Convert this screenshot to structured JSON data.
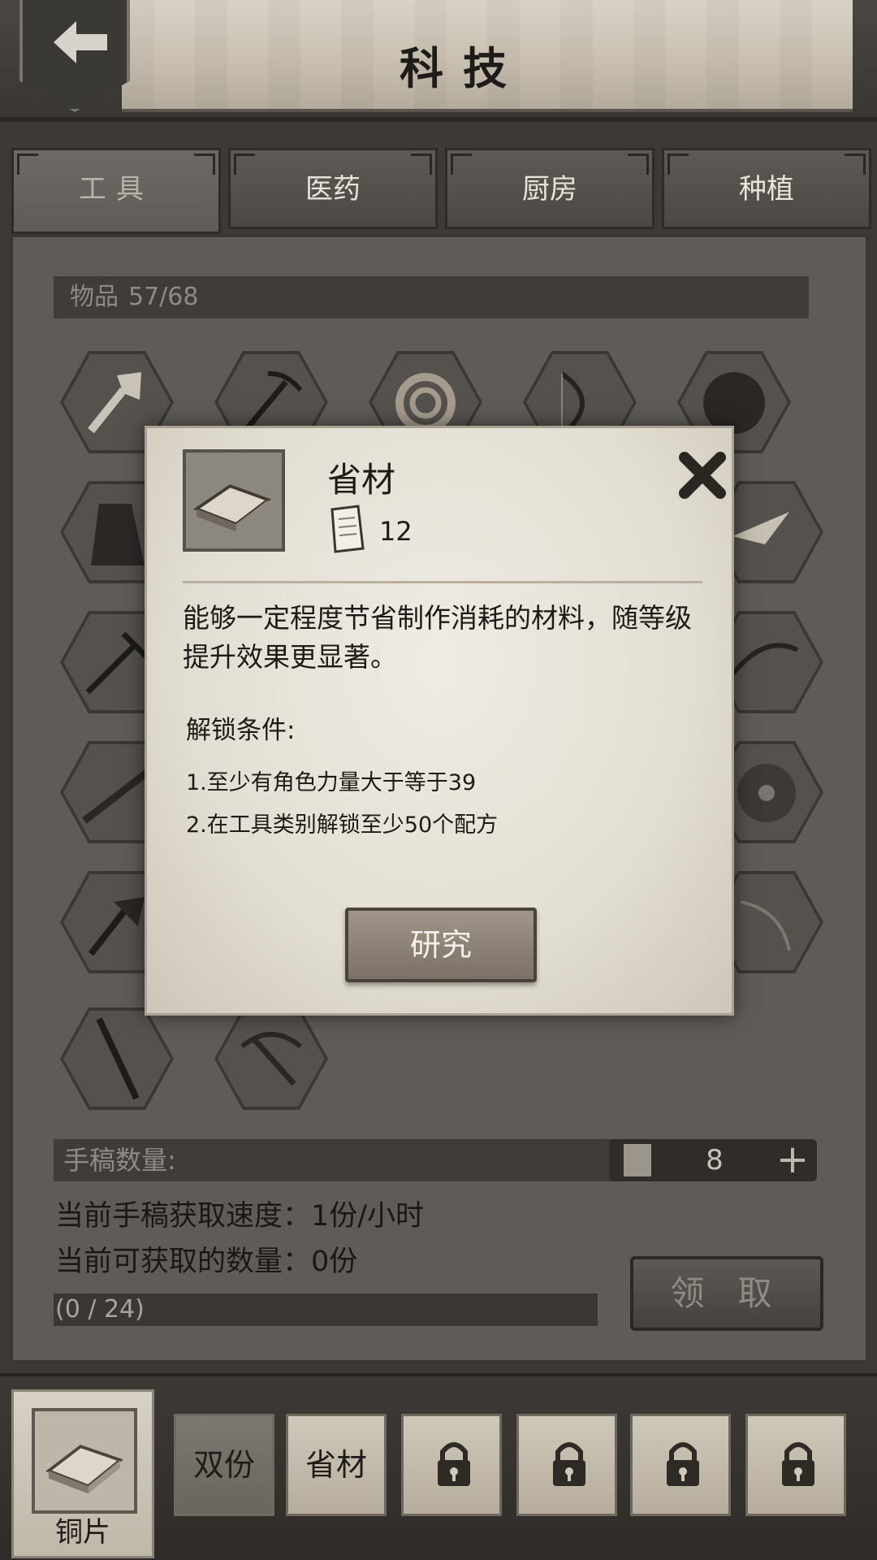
{
  "header": {
    "title": "科技"
  },
  "tabs": [
    {
      "label": "工具",
      "active": true
    },
    {
      "label": "医药",
      "active": false
    },
    {
      "label": "厨房",
      "active": false
    },
    {
      "label": "种植",
      "active": false
    }
  ],
  "items_bar": {
    "label": "物品",
    "count": "57/68"
  },
  "grid_icons": [
    "axe-icon",
    "pickaxe-icon",
    "rope-icon",
    "bow-icon",
    "shield-icon",
    "cloak-icon",
    "pickaxe-icon",
    "sword-icon",
    "battle-axe-icon",
    "spear-icon",
    "crossbow-icon"
  ],
  "manuscript": {
    "label": "手稿数量:",
    "value": "8",
    "plus": "+"
  },
  "rate_line": "当前手稿获取速度：1份/小时",
  "available_line": "当前可获取的数量：0份",
  "progress": {
    "text": "(0 / 24)",
    "current": 0,
    "max": 24
  },
  "claim_label": "领 取",
  "dialog": {
    "title": "省材",
    "cost": "12",
    "description": "能够一定程度节省制作消耗的材料，随等级提升效果更显著。",
    "unlock_title": "解锁条件:",
    "conditions": [
      "1.至少有角色力量大于等于39",
      "2.在工具类别解锁至少50个配方"
    ],
    "research_label": "研究"
  },
  "bottom_bar": {
    "main_slot_label": "铜片",
    "slots": [
      {
        "label": "双份",
        "locked": false
      },
      {
        "label": "省材",
        "locked": false
      },
      {
        "label": "",
        "locked": true
      },
      {
        "label": "",
        "locked": true
      },
      {
        "label": "",
        "locked": true
      },
      {
        "label": "",
        "locked": true
      }
    ]
  },
  "colors": {
    "panel": "#5f5c58",
    "parchment": "#e3ded3",
    "wood": "#7a7066"
  }
}
